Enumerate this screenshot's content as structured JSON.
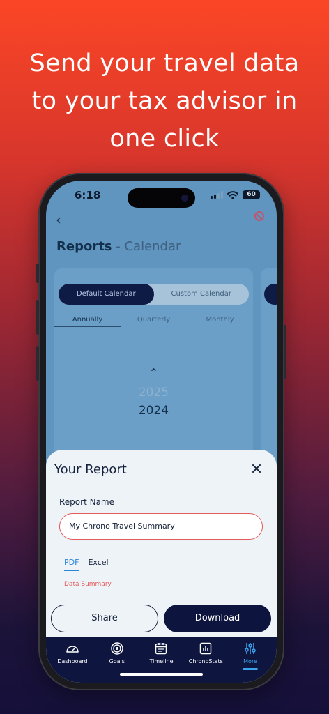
{
  "headline": [
    "Send your travel data",
    "to your tax advisor in",
    "one click"
  ],
  "status": {
    "time": "6:18",
    "battery": "60"
  },
  "background_app": {
    "title_bold": "Reports",
    "title_sep": " - ",
    "title_sub": "Calendar",
    "calendar_toggle": [
      "Default Calendar",
      "Custom Calendar"
    ],
    "period_tabs": [
      "Annually",
      "Quarterly",
      "Monthly"
    ],
    "year_faint": "2025",
    "year_selected": "2024"
  },
  "sheet": {
    "title": "Your Report",
    "report_name_label": "Report Name",
    "report_name_value": "My Chrono Travel Summary",
    "format_tabs": [
      "PDF",
      "Excel"
    ],
    "section_label": "Data Summary",
    "share_label": "Share",
    "download_label": "Download"
  },
  "nav": [
    {
      "label": "Dashboard",
      "icon": "gauge-icon"
    },
    {
      "label": "Goals",
      "icon": "target-icon"
    },
    {
      "label": "Timeline",
      "icon": "calendar-icon"
    },
    {
      "label": "ChronoStats",
      "icon": "chart-icon"
    },
    {
      "label": "More",
      "icon": "sliders-icon",
      "active": true
    }
  ],
  "colors": {
    "accent": "#2a86d8",
    "error": "#e25a5a",
    "primary": "#0d143e"
  }
}
